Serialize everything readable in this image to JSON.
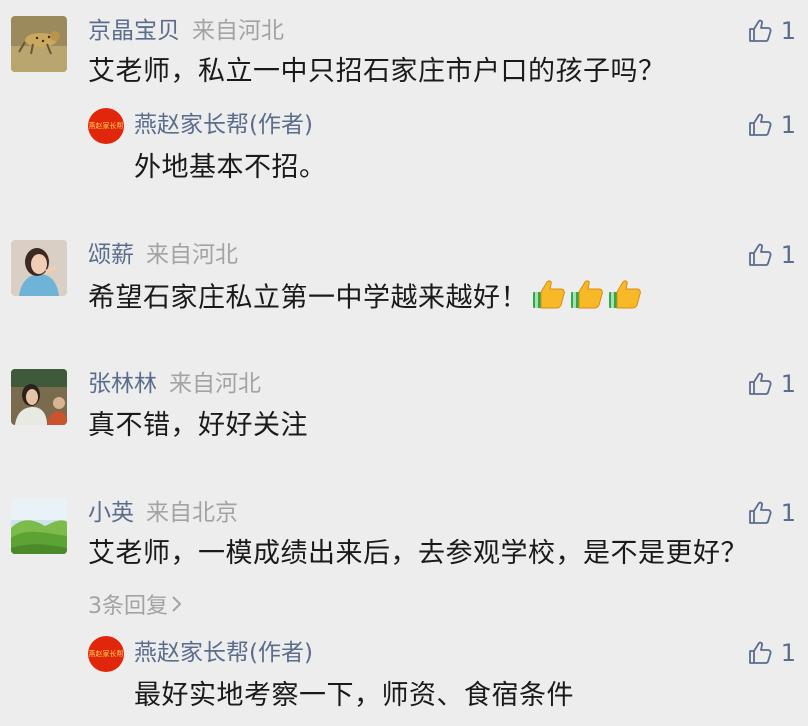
{
  "comments": [
    {
      "author": "京晶宝贝",
      "location": "来自河北",
      "text": "艾老师，私立一中只招石家庄市户口的孩子吗？",
      "likes": "1",
      "avatar_icon": "cheetah-photo",
      "reply": {
        "author": "燕赵家长帮(作者)",
        "avatar_text": "燕赵家长帮",
        "text": "外地基本不招。",
        "likes": "1"
      }
    },
    {
      "author": "颂薪",
      "location": "来自河北",
      "text": "希望石家庄私立第一中学越来越好！",
      "emoji": [
        "thumbs-up-emoji",
        "thumbs-up-emoji",
        "thumbs-up-emoji"
      ],
      "likes": "1",
      "avatar_icon": "girl-photo"
    },
    {
      "author": "张林林",
      "location": "来自河北",
      "text": "真不错，好好关注",
      "likes": "1",
      "avatar_icon": "people-photo"
    },
    {
      "author": "小英",
      "location": "来自北京",
      "text": "艾老师，一模成绩出来后，去参观学校，是不是更好？",
      "likes": "1",
      "avatar_icon": "landscape-photo",
      "more_replies": "3条回复",
      "reply": {
        "author": "燕赵家长帮(作者)",
        "avatar_text": "燕赵家长帮",
        "text": "最好实地考察一下，师资、食宿条件",
        "likes": "1"
      }
    }
  ],
  "colors": {
    "background": "#ededed",
    "name": "#5a6d8c",
    "location": "#a3a3a3",
    "text": "#1a1a1a",
    "author_badge": "#e0270b"
  }
}
